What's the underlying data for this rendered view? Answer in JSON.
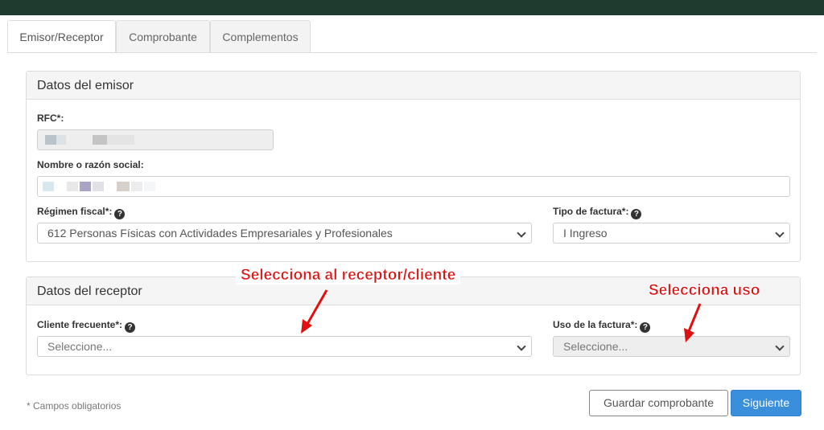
{
  "tabs": [
    {
      "label": "Emisor/Receptor",
      "active": true
    },
    {
      "label": "Comprobante",
      "active": false
    },
    {
      "label": "Complementos",
      "active": false
    }
  ],
  "emisor": {
    "title": "Datos del emisor",
    "rfc_label": "RFC*:",
    "nombre_label": "Nombre o razón social:",
    "regimen_label": "Régimen fiscal*:",
    "regimen_value": "612 Personas Físicas con Actividades Empresariales y Profesionales",
    "tipo_label": "Tipo de factura*:",
    "tipo_value": "I Ingreso"
  },
  "receptor": {
    "title": "Datos del receptor",
    "cliente_label": "Cliente frecuente*:",
    "cliente_placeholder": "Seleccione...",
    "uso_label": "Uso de la factura*:",
    "uso_placeholder": "Seleccione..."
  },
  "annotations": {
    "receptor": "Selecciona al receptor/cliente",
    "uso": "Selecciona uso",
    "color": "#e01010"
  },
  "footer": {
    "note": "* Campos obligatorios",
    "save_label": "Guardar comprobante",
    "next_label": "Siguiente"
  },
  "help_icon": "question-circle-icon",
  "colors": {
    "topbar": "#1f3a2e",
    "primary": "#3a8fdd"
  }
}
